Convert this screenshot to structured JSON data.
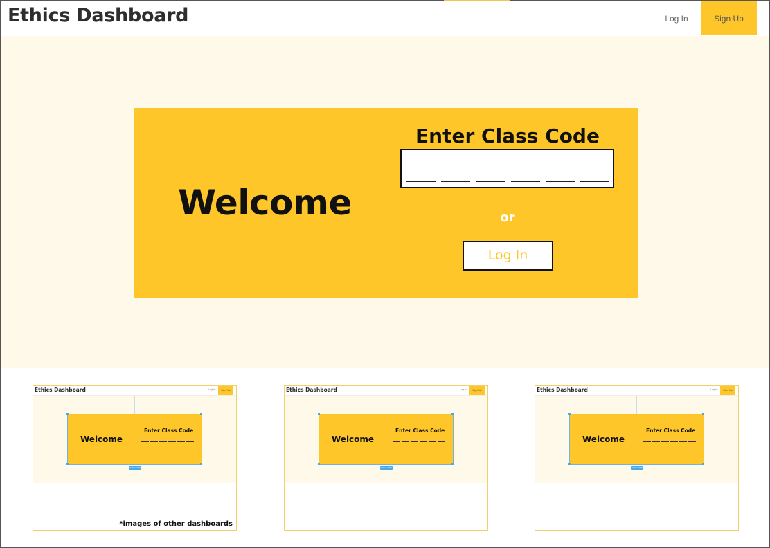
{
  "header": {
    "title": "Ethics Dashboard",
    "login_label": "Log In",
    "signup_label": "Sign Up"
  },
  "hero": {
    "welcome": "Welcome",
    "code_title": "Enter Class Code",
    "code_slots": 6,
    "or_label": "or",
    "login_button": "Log In"
  },
  "thumbnails": [
    {
      "title": "Ethics Dashboard",
      "login_label": "Log In",
      "signup_label": "Sign Up",
      "welcome": "Welcome",
      "code_title": "Enter Class Code",
      "size_badge": "640 × 256"
    },
    {
      "title": "Ethics Dashboard",
      "login_label": "Log In",
      "signup_label": "Sign Up",
      "welcome": "Welcome",
      "code_title": "Enter Class Code",
      "size_badge": "640 × 256"
    },
    {
      "title": "Ethics Dashboard",
      "login_label": "Log In",
      "signup_label": "Sign Up",
      "welcome": "Welcome",
      "code_title": "Enter Class Code",
      "size_badge": "640 × 256"
    }
  ],
  "thumbnails_note": "*images of other dashboards",
  "colors": {
    "accent": "#ffc629",
    "hero_background": "#fff9e9",
    "text": "#111111"
  }
}
